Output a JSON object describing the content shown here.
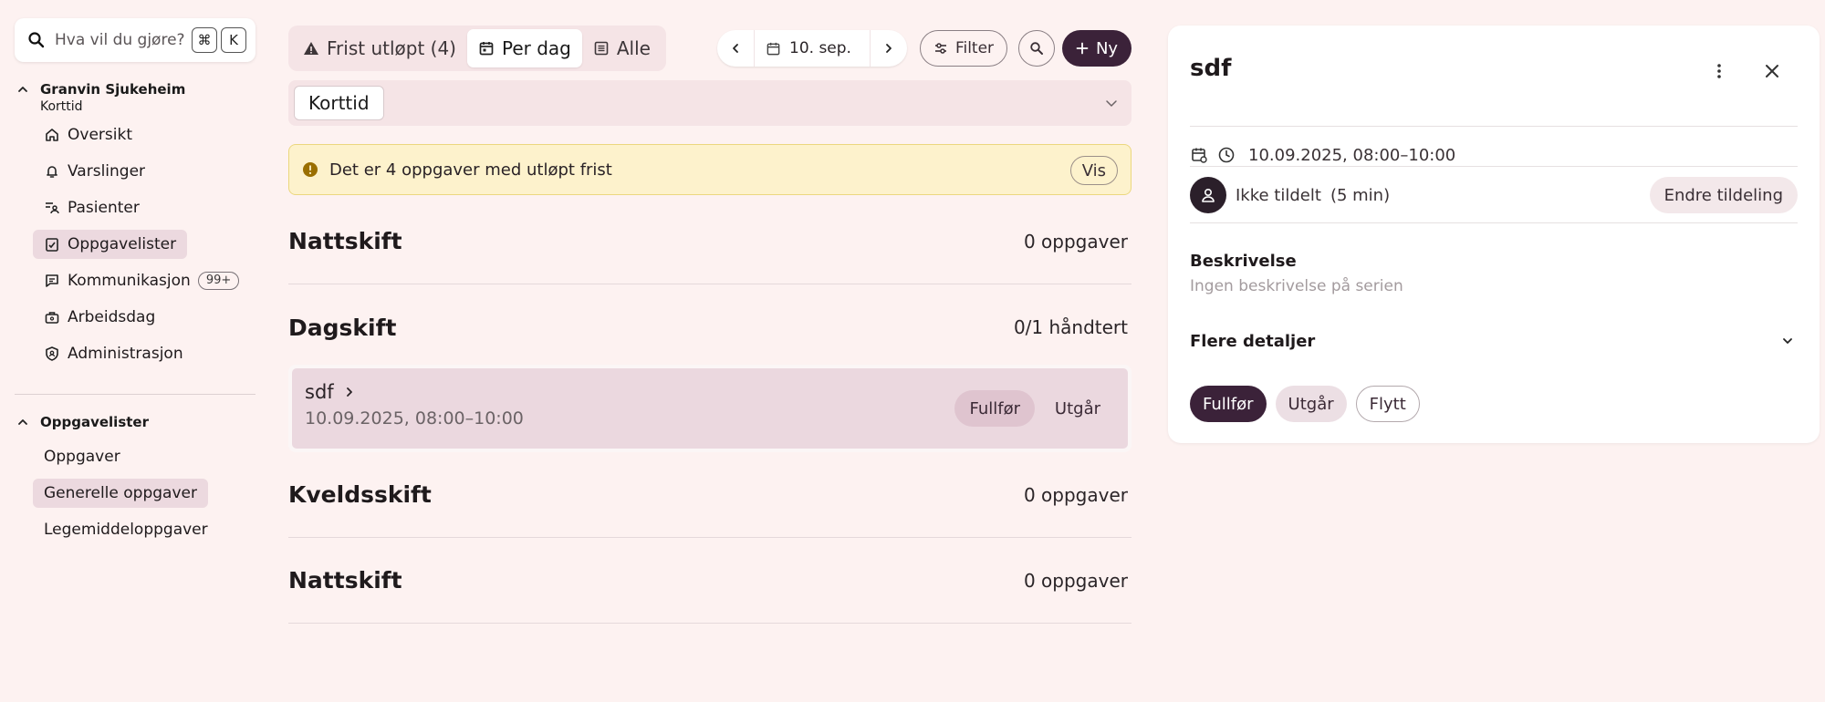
{
  "sidebar": {
    "search": {
      "placeholder": "Hva vil du gjøre?",
      "shortcut_mod": "⌘",
      "shortcut_key": "K"
    },
    "org": {
      "title": "Granvin Sjukeheim",
      "subtitle": "Korttid"
    },
    "items": [
      {
        "label": "Oversikt",
        "icon": "home-icon"
      },
      {
        "label": "Varslinger",
        "icon": "bell-icon"
      },
      {
        "label": "Pasienter",
        "icon": "patients-icon"
      },
      {
        "label": "Oppgavelister",
        "icon": "clipboard-check-icon"
      },
      {
        "label": "Kommunikasjon",
        "icon": "message-icon",
        "badge": "99+"
      },
      {
        "label": "Arbeidsdag",
        "icon": "briefcase-icon"
      },
      {
        "label": "Administrasjon",
        "icon": "shield-icon"
      }
    ],
    "tasklists": {
      "title": "Oppgavelister",
      "items": [
        {
          "label": "Oppgaver"
        },
        {
          "label": "Generelle oppgaver"
        },
        {
          "label": "Legemiddeloppgaver"
        }
      ]
    }
  },
  "toolbar": {
    "tabs": [
      {
        "label": "Frist utløpt (4)",
        "icon": "warning-icon"
      },
      {
        "label": "Per dag",
        "icon": "calendar-icon"
      },
      {
        "label": "Alle",
        "icon": "list-icon"
      }
    ],
    "date": "10. sep.",
    "filter_label": "Filter",
    "new_label": "Ny"
  },
  "filter_chip": "Korttid",
  "alert": {
    "text": "Det er 4 oppgaver med utløpt frist",
    "button": "Vis"
  },
  "sections": [
    {
      "title": "Nattskift",
      "count": "0 oppgaver"
    },
    {
      "title": "Dagskift",
      "count": "0/1 håndtert"
    },
    {
      "title": "Kveldsskift",
      "count": "0 oppgaver"
    },
    {
      "title": "Nattskift",
      "count": "0 oppgaver"
    }
  ],
  "task": {
    "name": "sdf",
    "time": "10.09.2025, 08:00–10:00",
    "complete_label": "Fullfør",
    "expire_label": "Utgår"
  },
  "detail": {
    "title": "sdf",
    "time": "10.09.2025, 08:00–10:00",
    "assignee": "Ikke tildelt",
    "duration": "(5 min)",
    "change_label": "Endre tildeling",
    "description_heading": "Beskrivelse",
    "description_text": "Ingen beskrivelse på serien",
    "more_details": "Flere detaljer",
    "actions": {
      "complete": "Fullfør",
      "expire": "Utgår",
      "move": "Flytt"
    }
  },
  "colors": {
    "background": "#fdf2f1",
    "accent": "#3b2239",
    "active_nav": "#ecd9df",
    "alert_bg": "#fdf2cc",
    "warning": "#b8860b"
  }
}
